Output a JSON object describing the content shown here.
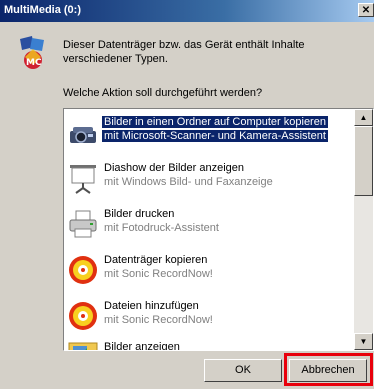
{
  "window": {
    "title": "MultiMedia (0:)",
    "close_label": "✕"
  },
  "description": "Dieser Datenträger bzw. das Gerät enthält Inhalte verschiedener Typen.",
  "question": "Welche Aktion soll durchgeführt werden?",
  "actions": [
    {
      "title": "Bilder in einen Ordner auf Computer kopieren",
      "subtitle": "mit Microsoft-Scanner- und Kamera-Assistent",
      "icon": "camera-icon",
      "selected": true
    },
    {
      "title": "Diashow der Bilder anzeigen",
      "subtitle": "mit Windows Bild- und Faxanzeige",
      "icon": "projector-screen-icon"
    },
    {
      "title": "Bilder drucken",
      "subtitle": "mit Fotodruck-Assistent",
      "icon": "printer-icon"
    },
    {
      "title": "Datenträger kopieren",
      "subtitle": "mit Sonic RecordNow!",
      "icon": "sonic-disc-icon"
    },
    {
      "title": "Dateien hinzufügen",
      "subtitle": "mit Sonic RecordNow!",
      "icon": "sonic-disc-icon"
    },
    {
      "title": "Bilder anzeigen",
      "subtitle": "",
      "icon": "picture-folder-icon"
    }
  ],
  "buttons": {
    "ok": "OK",
    "cancel": "Abbrechen"
  },
  "colors": {
    "selection": "#0a246a",
    "highlight_frame": "#e8000b",
    "dialog_bg": "#d4d0c8"
  }
}
